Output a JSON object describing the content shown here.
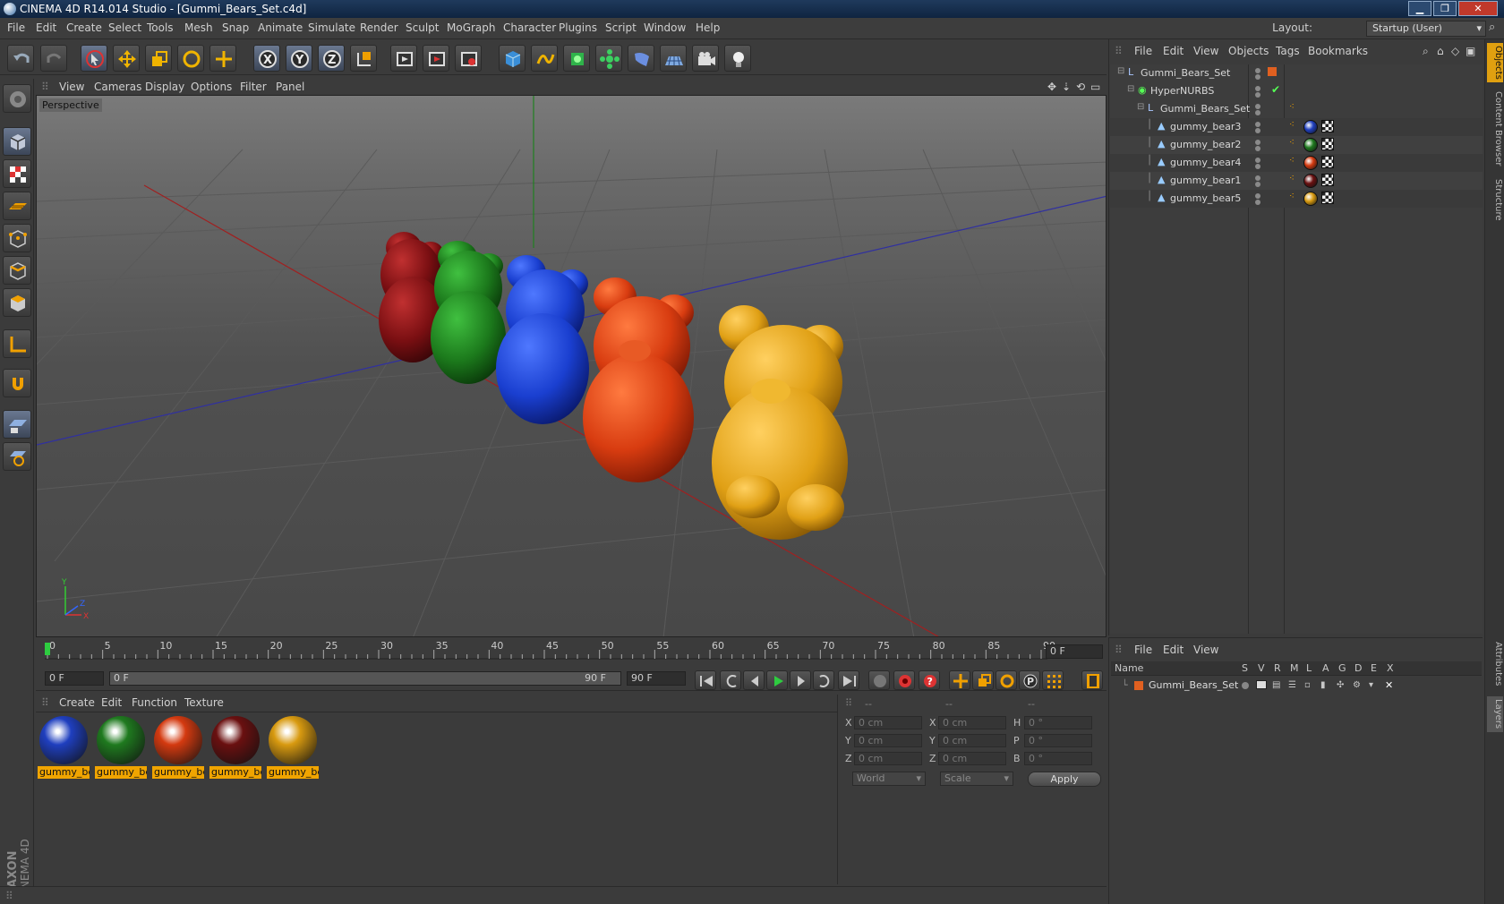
{
  "window": {
    "title": "CINEMA 4D R14.014 Studio - [Gummi_Bears_Set.c4d]"
  },
  "menubar": {
    "items": [
      "File",
      "Edit",
      "Create",
      "Select",
      "Tools",
      "Mesh",
      "Snap",
      "Animate",
      "Simulate",
      "Render",
      "Sculpt",
      "MoGraph",
      "Character",
      "Plugins",
      "Script",
      "Window",
      "Help"
    ],
    "layout_label": "Layout:",
    "layout_value": "Startup (User)"
  },
  "viewport": {
    "menu": [
      "View",
      "Cameras",
      "Display",
      "Options",
      "Filter",
      "Panel"
    ],
    "camera_label": "Perspective",
    "axes": {
      "x": "X",
      "y": "Y",
      "z": "Z"
    }
  },
  "timeline": {
    "ticks": [
      "0",
      "5",
      "10",
      "15",
      "20",
      "25",
      "30",
      "35",
      "40",
      "45",
      "50",
      "55",
      "60",
      "65",
      "70",
      "75",
      "80",
      "85",
      "90"
    ],
    "current_frame_display": "0 F",
    "start_field": "0 F",
    "range_start": "0 F",
    "range_end": "90 F",
    "end_field": "90 F"
  },
  "materials": {
    "menu": [
      "Create",
      "Edit",
      "Function",
      "Texture"
    ],
    "items": [
      {
        "label": "gummy_be",
        "color": "#1f3fbf"
      },
      {
        "label": "gummy_be",
        "color": "#1f7a1f"
      },
      {
        "label": "gummy_be",
        "color": "#d43a10"
      },
      {
        "label": "gummy_be",
        "color": "#6a1010"
      },
      {
        "label": "gummy_be",
        "color": "#d89a10"
      }
    ]
  },
  "coordinates": {
    "header": [
      "--",
      "--",
      "--"
    ],
    "rows": [
      {
        "l1": "X",
        "v1": "0 cm",
        "l2": "X",
        "v2": "0 cm",
        "l3": "H",
        "v3": "0 °"
      },
      {
        "l1": "Y",
        "v1": "0 cm",
        "l2": "Y",
        "v2": "0 cm",
        "l3": "P",
        "v3": "0 °"
      },
      {
        "l1": "Z",
        "v1": "0 cm",
        "l2": "Z",
        "v2": "0 cm",
        "l3": "B",
        "v3": "0 °"
      }
    ],
    "space_select": "World",
    "mode_select": "Scale",
    "apply_label": "Apply"
  },
  "object_manager": {
    "menu": [
      "File",
      "Edit",
      "View",
      "Objects",
      "Tags",
      "Bookmarks"
    ],
    "objects": [
      {
        "name": "Gummi_Bears_Set",
        "indent": 0,
        "type": "null"
      },
      {
        "name": "HyperNURBS",
        "indent": 1,
        "type": "nurbs"
      },
      {
        "name": "Gummi_Bears_Set",
        "indent": 2,
        "type": "null"
      },
      {
        "name": "gummy_bear3",
        "indent": 3,
        "type": "poly",
        "mat": "#1f3fbf"
      },
      {
        "name": "gummy_bear2",
        "indent": 3,
        "type": "poly",
        "mat": "#1f7a1f"
      },
      {
        "name": "gummy_bear4",
        "indent": 3,
        "type": "poly",
        "mat": "#d43a10"
      },
      {
        "name": "gummy_bear1",
        "indent": 3,
        "type": "poly",
        "mat": "#6a1010"
      },
      {
        "name": "gummy_bear5",
        "indent": 3,
        "type": "poly",
        "mat": "#d89a10"
      }
    ]
  },
  "layer_manager": {
    "menu": [
      "File",
      "Edit",
      "View"
    ],
    "columns": [
      "Name",
      "S",
      "V",
      "R",
      "M",
      "L",
      "A",
      "G",
      "D",
      "E",
      "X"
    ],
    "layers": [
      {
        "name": "Gummi_Bears_Set",
        "color": "#e06020"
      }
    ]
  },
  "side_tabs": [
    "Objects",
    "Content Browser",
    "Structure",
    "Attributes",
    "Layers"
  ],
  "branding": {
    "logo": "MAXON CINEMA 4D"
  }
}
